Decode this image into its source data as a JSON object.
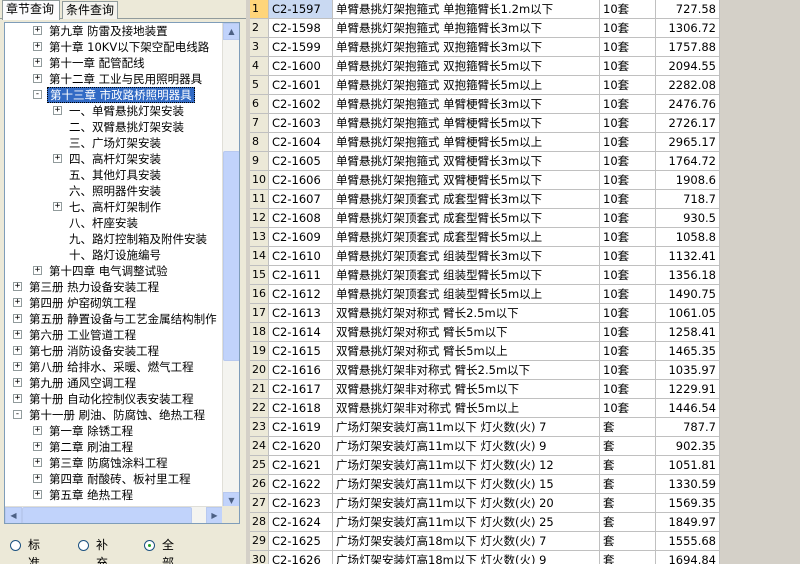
{
  "tabs": [
    {
      "label": "章节查询",
      "active": true
    },
    {
      "label": "条件查询",
      "active": false
    }
  ],
  "tree": {
    "nodes": [
      {
        "label": "第九章  防雷及接地装置",
        "level": 2,
        "expander": "+"
      },
      {
        "label": "第十章  10KV以下架空配电线路",
        "level": 2,
        "expander": "+"
      },
      {
        "label": "第十一章  配管配线",
        "level": 2,
        "expander": "+"
      },
      {
        "label": "第十二章  工业与民用照明器具",
        "level": 2,
        "expander": "+"
      },
      {
        "label": "第十三章  市政路桥照明器具",
        "level": 2,
        "expander": "-",
        "selected": true
      },
      {
        "label": "一、单臂悬挑灯架安装",
        "level": 3,
        "expander": "+"
      },
      {
        "label": "二、双臂悬挑灯架安装",
        "level": 3,
        "expander": ""
      },
      {
        "label": "三、广场灯架安装",
        "level": 3,
        "expander": ""
      },
      {
        "label": "四、高杆灯架安装",
        "level": 3,
        "expander": "+"
      },
      {
        "label": "五、其他灯具安装",
        "level": 3,
        "expander": ""
      },
      {
        "label": "六、照明器件安装",
        "level": 3,
        "expander": ""
      },
      {
        "label": "七、高杆灯架制作",
        "level": 3,
        "expander": "+"
      },
      {
        "label": "八、杆座安装",
        "level": 3,
        "expander": ""
      },
      {
        "label": "九、路灯控制箱及附件安装",
        "level": 3,
        "expander": ""
      },
      {
        "label": "十、路灯设施编号",
        "level": 3,
        "expander": ""
      },
      {
        "label": "第十四章  电气调整试验",
        "level": 2,
        "expander": "+"
      },
      {
        "label": "第三册  热力设备安装工程",
        "level": 1,
        "expander": "+"
      },
      {
        "label": "第四册  炉窑砌筑工程",
        "level": 1,
        "expander": "+"
      },
      {
        "label": "第五册  静置设备与工艺金属结构制作",
        "level": 1,
        "expander": "+"
      },
      {
        "label": "第六册  工业管道工程",
        "level": 1,
        "expander": "+"
      },
      {
        "label": "第七册  消防设备安装工程",
        "level": 1,
        "expander": "+"
      },
      {
        "label": "第八册  给排水、采暖、燃气工程",
        "level": 1,
        "expander": "+"
      },
      {
        "label": "第九册  通风空调工程",
        "level": 1,
        "expander": "+"
      },
      {
        "label": "第十册  自动化控制仪表安装工程",
        "level": 1,
        "expander": "+"
      },
      {
        "label": "第十一册  刷油、防腐蚀、绝热工程",
        "level": 1,
        "expander": "-"
      },
      {
        "label": "第一章  除锈工程",
        "level": 2,
        "expander": "+"
      },
      {
        "label": "第二章  刷油工程",
        "level": 2,
        "expander": "+"
      },
      {
        "label": "第三章  防腐蚀涂料工程",
        "level": 2,
        "expander": "+"
      },
      {
        "label": "第四章  耐酸砖、板衬里工程",
        "level": 2,
        "expander": "+"
      },
      {
        "label": "第五章  绝热工程",
        "level": 2,
        "expander": "+"
      }
    ],
    "scroll_up_icon": "▲",
    "scroll_down_icon": "▼",
    "scroll_left_icon": "◀",
    "scroll_right_icon": "▶"
  },
  "filter": {
    "options": [
      {
        "label": "标准",
        "checked": false
      },
      {
        "label": "补充",
        "checked": false
      },
      {
        "label": "全部",
        "checked": true
      }
    ]
  },
  "grid": {
    "rows": [
      {
        "no": "1",
        "code": "C2-1597",
        "name": "单臂悬挑灯架抱箍式 单抱箍臂长1.2m以下",
        "unit": "10套",
        "price": "727.58"
      },
      {
        "no": "2",
        "code": "C2-1598",
        "name": "单臂悬挑灯架抱箍式 单抱箍臂长3m以下",
        "unit": "10套",
        "price": "1306.72"
      },
      {
        "no": "3",
        "code": "C2-1599",
        "name": "单臂悬挑灯架抱箍式 双抱箍臂长3m以下",
        "unit": "10套",
        "price": "1757.88"
      },
      {
        "no": "4",
        "code": "C2-1600",
        "name": "单臂悬挑灯架抱箍式 双抱箍臂长5m以下",
        "unit": "10套",
        "price": "2094.55"
      },
      {
        "no": "5",
        "code": "C2-1601",
        "name": "单臂悬挑灯架抱箍式 双抱箍臂长5m以上",
        "unit": "10套",
        "price": "2282.08"
      },
      {
        "no": "6",
        "code": "C2-1602",
        "name": "单臂悬挑灯架抱箍式 单臂梗臂长3m以下",
        "unit": "10套",
        "price": "2476.76"
      },
      {
        "no": "7",
        "code": "C2-1603",
        "name": "单臂悬挑灯架抱箍式 单臂梗臂长5m以下",
        "unit": "10套",
        "price": "2726.17"
      },
      {
        "no": "8",
        "code": "C2-1604",
        "name": "单臂悬挑灯架抱箍式 单臂梗臂长5m以上",
        "unit": "10套",
        "price": "2965.17"
      },
      {
        "no": "9",
        "code": "C2-1605",
        "name": "单臂悬挑灯架抱箍式 双臂梗臂长3m以下",
        "unit": "10套",
        "price": "1764.72"
      },
      {
        "no": "10",
        "code": "C2-1606",
        "name": "单臂悬挑灯架抱箍式 双臂梗臂长5m以下",
        "unit": "10套",
        "price": "1908.6"
      },
      {
        "no": "11",
        "code": "C2-1607",
        "name": "单臂悬挑灯架顶套式 成套型臂长3m以下",
        "unit": "10套",
        "price": "718.7"
      },
      {
        "no": "12",
        "code": "C2-1608",
        "name": "单臂悬挑灯架顶套式 成套型臂长5m以下",
        "unit": "10套",
        "price": "930.5"
      },
      {
        "no": "13",
        "code": "C2-1609",
        "name": "单臂悬挑灯架顶套式 成套型臂长5m以上",
        "unit": "10套",
        "price": "1058.8"
      },
      {
        "no": "14",
        "code": "C2-1610",
        "name": "单臂悬挑灯架顶套式 组装型臂长3m以下",
        "unit": "10套",
        "price": "1132.41"
      },
      {
        "no": "15",
        "code": "C2-1611",
        "name": "单臂悬挑灯架顶套式 组装型臂长5m以下",
        "unit": "10套",
        "price": "1356.18"
      },
      {
        "no": "16",
        "code": "C2-1612",
        "name": "单臂悬挑灯架顶套式 组装型臂长5m以上",
        "unit": "10套",
        "price": "1490.75"
      },
      {
        "no": "17",
        "code": "C2-1613",
        "name": "双臂悬挑灯架对称式 臂长2.5m以下",
        "unit": "10套",
        "price": "1061.05"
      },
      {
        "no": "18",
        "code": "C2-1614",
        "name": "双臂悬挑灯架对称式 臂长5m以下",
        "unit": "10套",
        "price": "1258.41"
      },
      {
        "no": "19",
        "code": "C2-1615",
        "name": "双臂悬挑灯架对称式 臂长5m以上",
        "unit": "10套",
        "price": "1465.35"
      },
      {
        "no": "20",
        "code": "C2-1616",
        "name": "双臂悬挑灯架非对称式 臂长2.5m以下",
        "unit": "10套",
        "price": "1035.97"
      },
      {
        "no": "21",
        "code": "C2-1617",
        "name": "双臂悬挑灯架非对称式 臂长5m以下",
        "unit": "10套",
        "price": "1229.91"
      },
      {
        "no": "22",
        "code": "C2-1618",
        "name": "双臂悬挑灯架非对称式 臂长5m以上",
        "unit": "10套",
        "price": "1446.54"
      },
      {
        "no": "23",
        "code": "C2-1619",
        "name": "广场灯架安装灯高11m以下 灯火数(火) 7",
        "unit": "套",
        "price": "787.7"
      },
      {
        "no": "24",
        "code": "C2-1620",
        "name": "广场灯架安装灯高11m以下 灯火数(火) 9",
        "unit": "套",
        "price": "902.35"
      },
      {
        "no": "25",
        "code": "C2-1621",
        "name": "广场灯架安装灯高11m以下 灯火数(火) 12",
        "unit": "套",
        "price": "1051.81"
      },
      {
        "no": "26",
        "code": "C2-1622",
        "name": "广场灯架安装灯高11m以下 灯火数(火) 15",
        "unit": "套",
        "price": "1330.59"
      },
      {
        "no": "27",
        "code": "C2-1623",
        "name": "广场灯架安装灯高11m以下 灯火数(火) 20",
        "unit": "套",
        "price": "1569.35"
      },
      {
        "no": "28",
        "code": "C2-1624",
        "name": "广场灯架安装灯高11m以下 灯火数(火) 25",
        "unit": "套",
        "price": "1849.97"
      },
      {
        "no": "29",
        "code": "C2-1625",
        "name": "广场灯架安装灯高18m以下 灯火数(火) 7",
        "unit": "套",
        "price": "1555.68"
      },
      {
        "no": "30",
        "code": "C2-1626",
        "name": "广场灯架安装灯高18m以下 灯火数(火) 9",
        "unit": "套",
        "price": "1694.84"
      }
    ]
  },
  "colors": {
    "selection": "#316ac5",
    "row_highlight": "#ffd57a",
    "code_highlight": "#c9d9f2"
  }
}
